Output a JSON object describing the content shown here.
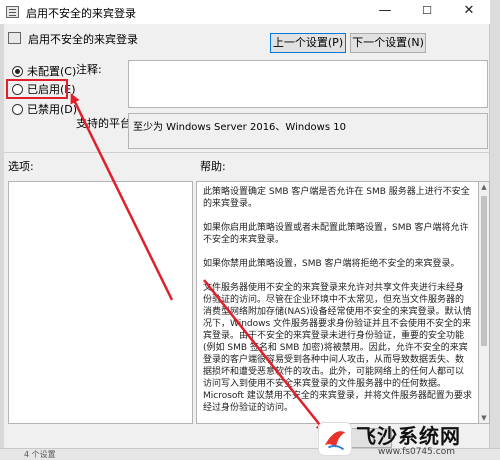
{
  "window": {
    "title": "启用不安全的来宾登录",
    "minimize": "—",
    "maximize": "☐",
    "close": "✕"
  },
  "header": {
    "setting_name": "启用不安全的来宾登录",
    "prev_button": "上一个设置(P)",
    "next_button": "下一个设置(N)"
  },
  "options": [
    {
      "label": "未配置(C)",
      "checked": true
    },
    {
      "label": "已启用(E)",
      "checked": false
    },
    {
      "label": "已禁用(D)",
      "checked": false
    }
  ],
  "comment": {
    "label": "注释:",
    "value": ""
  },
  "platform": {
    "label": "支持的平台:",
    "value": "至少为 Windows Server 2016、Windows 10"
  },
  "options_section": {
    "label": "选项:"
  },
  "help_section": {
    "label": "帮助:",
    "paragraphs": [
      "此策略设置确定 SMB 客户端是否允许在 SMB 服务器上进行不安全的来宾登录。",
      "如果你启用此策略设置或者未配置此策略设置，SMB 客户端将允许不安全的来宾登录。",
      "如果你禁用此策略设置，SMB 客户端将拒绝不安全的来宾登录。",
      "文件服务器使用不安全的来宾登录来允许对共享文件夹进行未经身份验证的访问。尽管在企业环境中不太常见，但充当文件服务器的消费型网络附加存储(NAS)设备经常使用不安全的来宾登录。默认情况下，Windows 文件服务器要求身份验证并且不会使用不安全的来宾登录。由于不安全的来宾登录未进行身份验证，重要的安全功能(例如 SMB 签名和 SMB 加密)将被禁用。因此，允许不安全的来宾登录的客户端很容易受到各种中间人攻击，从而导致数据丢失、数据损坏和遭受恶意软件的攻击。此外，可能网络上的任何人都可以访问写入到使用不安全来宾登录的文件服务器中的任何数据。Microsoft 建议禁用不安全的来宾登录，并将文件服务器配置为要求经过身份验证的访问。"
    ]
  },
  "statusbar": {
    "text": "4 个设置"
  },
  "watermark": {
    "text": "飞沙系统网",
    "url": "www.fs0745.com"
  },
  "colors": {
    "highlight": "#e0202a",
    "arrow": "#e0202a",
    "accent": "#0078d7"
  }
}
